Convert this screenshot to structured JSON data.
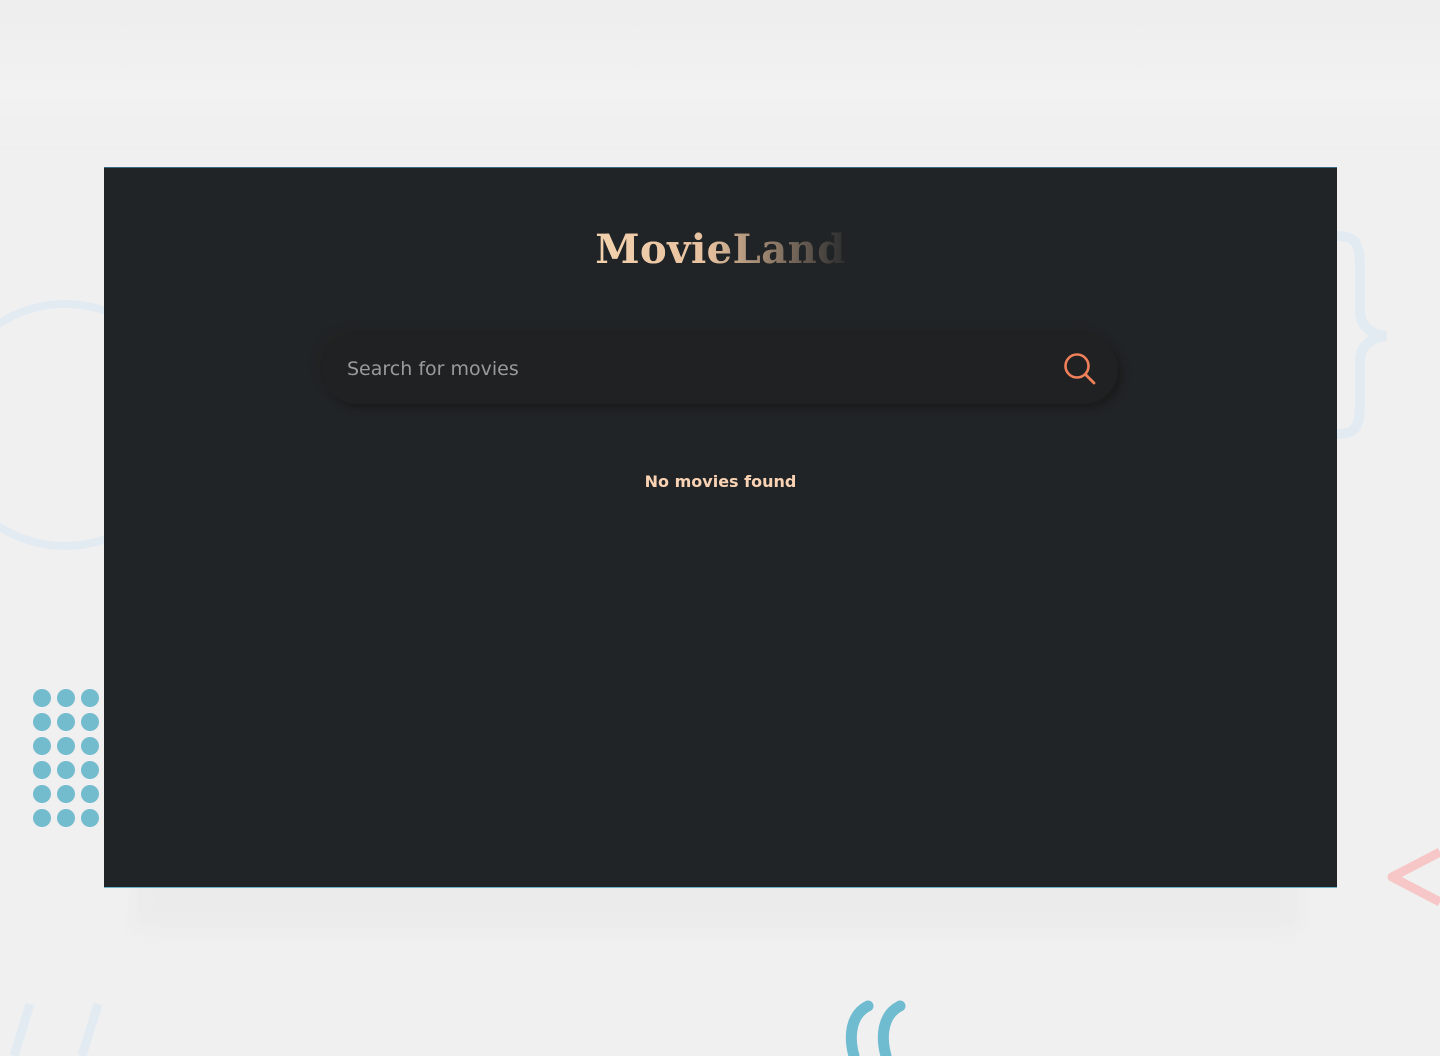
{
  "app": {
    "title": "MovieLand"
  },
  "search": {
    "placeholder": "Search for movies",
    "value": "",
    "icon": "search-icon"
  },
  "results": {
    "empty_message": "No movies found"
  },
  "colors": {
    "window_background": "#212427",
    "page_background": "#f0f0f0",
    "accent": "#f9d3b4",
    "search_icon": "#f0805a",
    "decor_blue": "#6fbbcf",
    "decor_pink": "#f7c6c6"
  }
}
